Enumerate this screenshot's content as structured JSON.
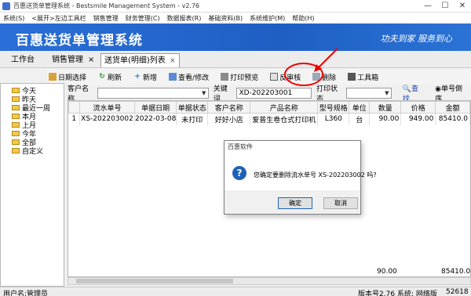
{
  "window": {
    "title": "百惠送货单管理系统 - Bestsmile Management System - v2.76",
    "min": "—",
    "max": "☐",
    "close": "✕"
  },
  "menu": [
    "系统(S)",
    "<展开>左边工具栏",
    "销售管理",
    "财务管理(C)",
    "数据报表(R)",
    "基础资料(B)",
    "系统维护(M)",
    "帮助(H)"
  ],
  "banner": {
    "title": "百惠送货单管理系统",
    "slogan": "功夫到家  服务到心"
  },
  "tabs": {
    "home": "工作台",
    "sales": "销售管理",
    "current": "送货单(明细)列表",
    "close": "×"
  },
  "toolbar": {
    "daily_select": "日期选择",
    "refresh": "刷新",
    "add": "新增",
    "view_edit": "查看/修改",
    "print_preview": "打印预览",
    "reverse_audit": "反审核",
    "delete": "删除",
    "toolbox": "工具箱"
  },
  "tree": [
    "今天",
    "昨天",
    "最近一周",
    "本月",
    "上月",
    "今年",
    "全部",
    "自定义"
  ],
  "filter": {
    "customer_label": "客户名称",
    "keyword_label": "关键词",
    "keyword_value": "XD-202203001",
    "print_status_label": "打印状态",
    "search": "查找..",
    "sort_option": "单号倒序"
  },
  "grid": {
    "columns": [
      "",
      "流水单号",
      "单据日期",
      "单据状态",
      "客户名称",
      "产品名称",
      "型号规格",
      "单位",
      "数量",
      "价格",
      "金额"
    ],
    "rows": [
      [
        "1",
        "XS-202203002",
        "2022-03-08",
        "未打印",
        "好好小店",
        "爱普生卷仓式打印机",
        "L360",
        "台",
        "90.00",
        "949.00",
        "85410.0"
      ]
    ],
    "totals": {
      "quantity": "90.00",
      "amount": "85410.0"
    }
  },
  "status": {
    "user": "用户名:管理员",
    "version": "版本号2.76",
    "edition": "系统: 网络版",
    "tail": "52618"
  },
  "dialog": {
    "title": "百惠软件",
    "message": "您确定要删除流水单号 XS-202203002 吗?",
    "ok": "确定",
    "cancel": "取消"
  }
}
